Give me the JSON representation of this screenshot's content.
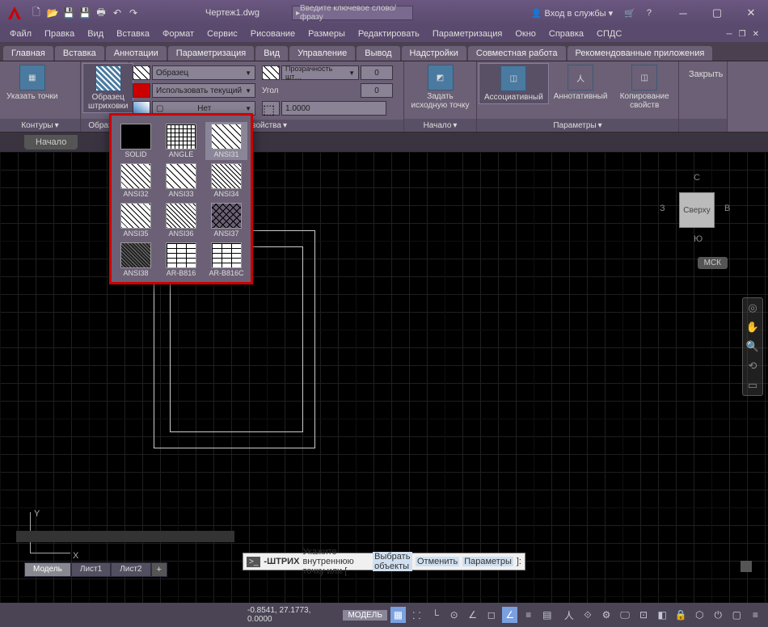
{
  "title": {
    "file": "Чертеж1.dwg",
    "search_placeholder": "Введите ключевое слово/фразу",
    "login": "Вход в службы"
  },
  "menus": [
    "Файл",
    "Правка",
    "Вид",
    "Вставка",
    "Формат",
    "Сервис",
    "Рисование",
    "Размеры",
    "Редактировать",
    "Параметризация",
    "Окно",
    "Справка",
    "СПДС"
  ],
  "tabs": [
    "Главная",
    "Вставка",
    "Аннотации",
    "Параметризация",
    "Вид",
    "Управление",
    "Вывод",
    "Надстройки",
    "Совместная работа",
    "Рекомендованные приложения"
  ],
  "ribbon": {
    "contours": {
      "btn": "Указать точки",
      "label": "Контуры"
    },
    "patterns": {
      "btn": "Образец штриховки",
      "label": "Образец"
    },
    "props": {
      "type": "Образец",
      "color_label": "Использовать текущий",
      "none": "Нет",
      "transparency": "Прозрачность шт…",
      "angle": "Угол",
      "t_val": "0",
      "a_val": "0",
      "scale": "1.0000",
      "label": "Свойства"
    },
    "origin": {
      "btn": "Задать исходную точку",
      "label": "Начало"
    },
    "opts": {
      "assoc": "Ассоциативный",
      "annot": "Аннотативный",
      "copy": "Копирование свойств",
      "label": "Параметры"
    },
    "close": "Закрыть"
  },
  "filetab": "Начало",
  "patterns": [
    "SOLID",
    "ANGLE",
    "ANSI31",
    "ANSI32",
    "ANSI33",
    "ANSI34",
    "ANSI35",
    "ANSI36",
    "ANSI37",
    "ANSI38",
    "AR-B816",
    "AR-B816C"
  ],
  "viewcube": {
    "top": "Сверху",
    "n": "С",
    "s": "Ю",
    "e": "В",
    "w": "З"
  },
  "wcs": "МСК",
  "cmd": {
    "prefix": "-ШТРИХ",
    "text": "Укажите внутреннюю точку или [",
    "o1": "Выбрать объекты",
    "o2": "Отменить",
    "o3": "Параметры",
    "suffix": "]:"
  },
  "layouts": [
    "Модель",
    "Лист1",
    "Лист2"
  ],
  "status": {
    "coords": "-0.8541, 27.1773, 0.0000",
    "mode": "МОДЕЛЬ"
  }
}
